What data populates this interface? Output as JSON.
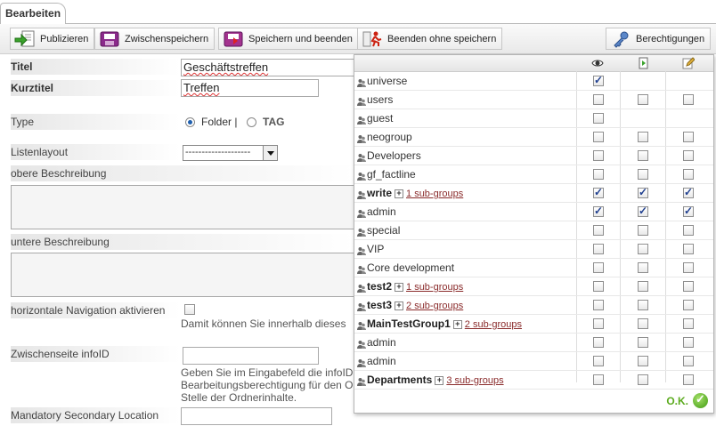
{
  "tab": {
    "label": "Bearbeiten"
  },
  "toolbar": {
    "publish": "Publizieren",
    "save_draft": "Zwischenspeichern",
    "save_close": "Speichern und beenden",
    "close_nosave": "Beenden ohne speichern",
    "permissions": "Berechtigungen"
  },
  "form": {
    "title_label": "Titel",
    "title_value": "Geschäftstreffen",
    "short_label": "Kurztitel",
    "short_value": "Treffen",
    "type_label": "Type",
    "type_folder": "Folder |",
    "type_tag": "TAG",
    "list_label": "Listenlayout",
    "list_value": "--------------------",
    "upper_desc_label": "obere Beschreibung",
    "lower_desc_label": "untere Beschreibung",
    "hnav_label": "horizontale Navigation aktivieren",
    "hnav_desc": "Damit können Sie innerhalb dieses",
    "interpage_label": "Zwischenseite infoID",
    "interpage_desc1": "Geben Sie im Eingabefeld die infoID",
    "interpage_desc2": "Bearbeitungsberechtigung für den O",
    "interpage_desc3": "Stelle der Ordnerinhalte.",
    "mandatory_label": "Mandatory Secondary Location"
  },
  "permissions": {
    "columns": [
      "view-icon",
      "enter-icon",
      "edit-icon"
    ],
    "groups": [
      {
        "name": "universe",
        "bold": false,
        "sub": "",
        "checks": [
          true,
          null,
          null
        ]
      },
      {
        "name": "users",
        "bold": false,
        "sub": "",
        "checks": [
          false,
          false,
          false
        ]
      },
      {
        "name": "guest",
        "bold": false,
        "sub": "",
        "checks": [
          false,
          null,
          null
        ]
      },
      {
        "name": "neogroup",
        "bold": false,
        "sub": "",
        "checks": [
          false,
          false,
          false
        ]
      },
      {
        "name": "Developers",
        "bold": false,
        "sub": "",
        "checks": [
          false,
          false,
          false
        ]
      },
      {
        "name": "gf_factline",
        "bold": false,
        "sub": "",
        "checks": [
          false,
          false,
          false
        ]
      },
      {
        "name": "write",
        "bold": true,
        "sub": "1 sub-groups",
        "checks": [
          true,
          true,
          true
        ]
      },
      {
        "name": "admin",
        "bold": false,
        "sub": "",
        "checks": [
          true,
          true,
          true
        ]
      },
      {
        "name": "special",
        "bold": false,
        "sub": "",
        "checks": [
          false,
          false,
          false
        ]
      },
      {
        "name": "VIP",
        "bold": false,
        "sub": "",
        "checks": [
          false,
          false,
          false
        ]
      },
      {
        "name": "Core development",
        "bold": false,
        "sub": "",
        "checks": [
          false,
          false,
          false
        ]
      },
      {
        "name": "test2",
        "bold": true,
        "sub": "1 sub-groups",
        "checks": [
          false,
          false,
          false
        ]
      },
      {
        "name": "test3",
        "bold": true,
        "sub": "2 sub-groups",
        "checks": [
          false,
          false,
          false
        ]
      },
      {
        "name": "MainTestGroup1",
        "bold": true,
        "sub": "2 sub-groups",
        "checks": [
          false,
          false,
          false
        ]
      },
      {
        "name": "admin",
        "bold": false,
        "sub": "",
        "checks": [
          false,
          false,
          false
        ]
      },
      {
        "name": "admin",
        "bold": false,
        "sub": "",
        "checks": [
          false,
          false,
          false
        ]
      },
      {
        "name": "Departments",
        "bold": true,
        "sub": "3 sub-groups",
        "checks": [
          false,
          false,
          false
        ]
      }
    ],
    "ok_label": "O.K."
  }
}
